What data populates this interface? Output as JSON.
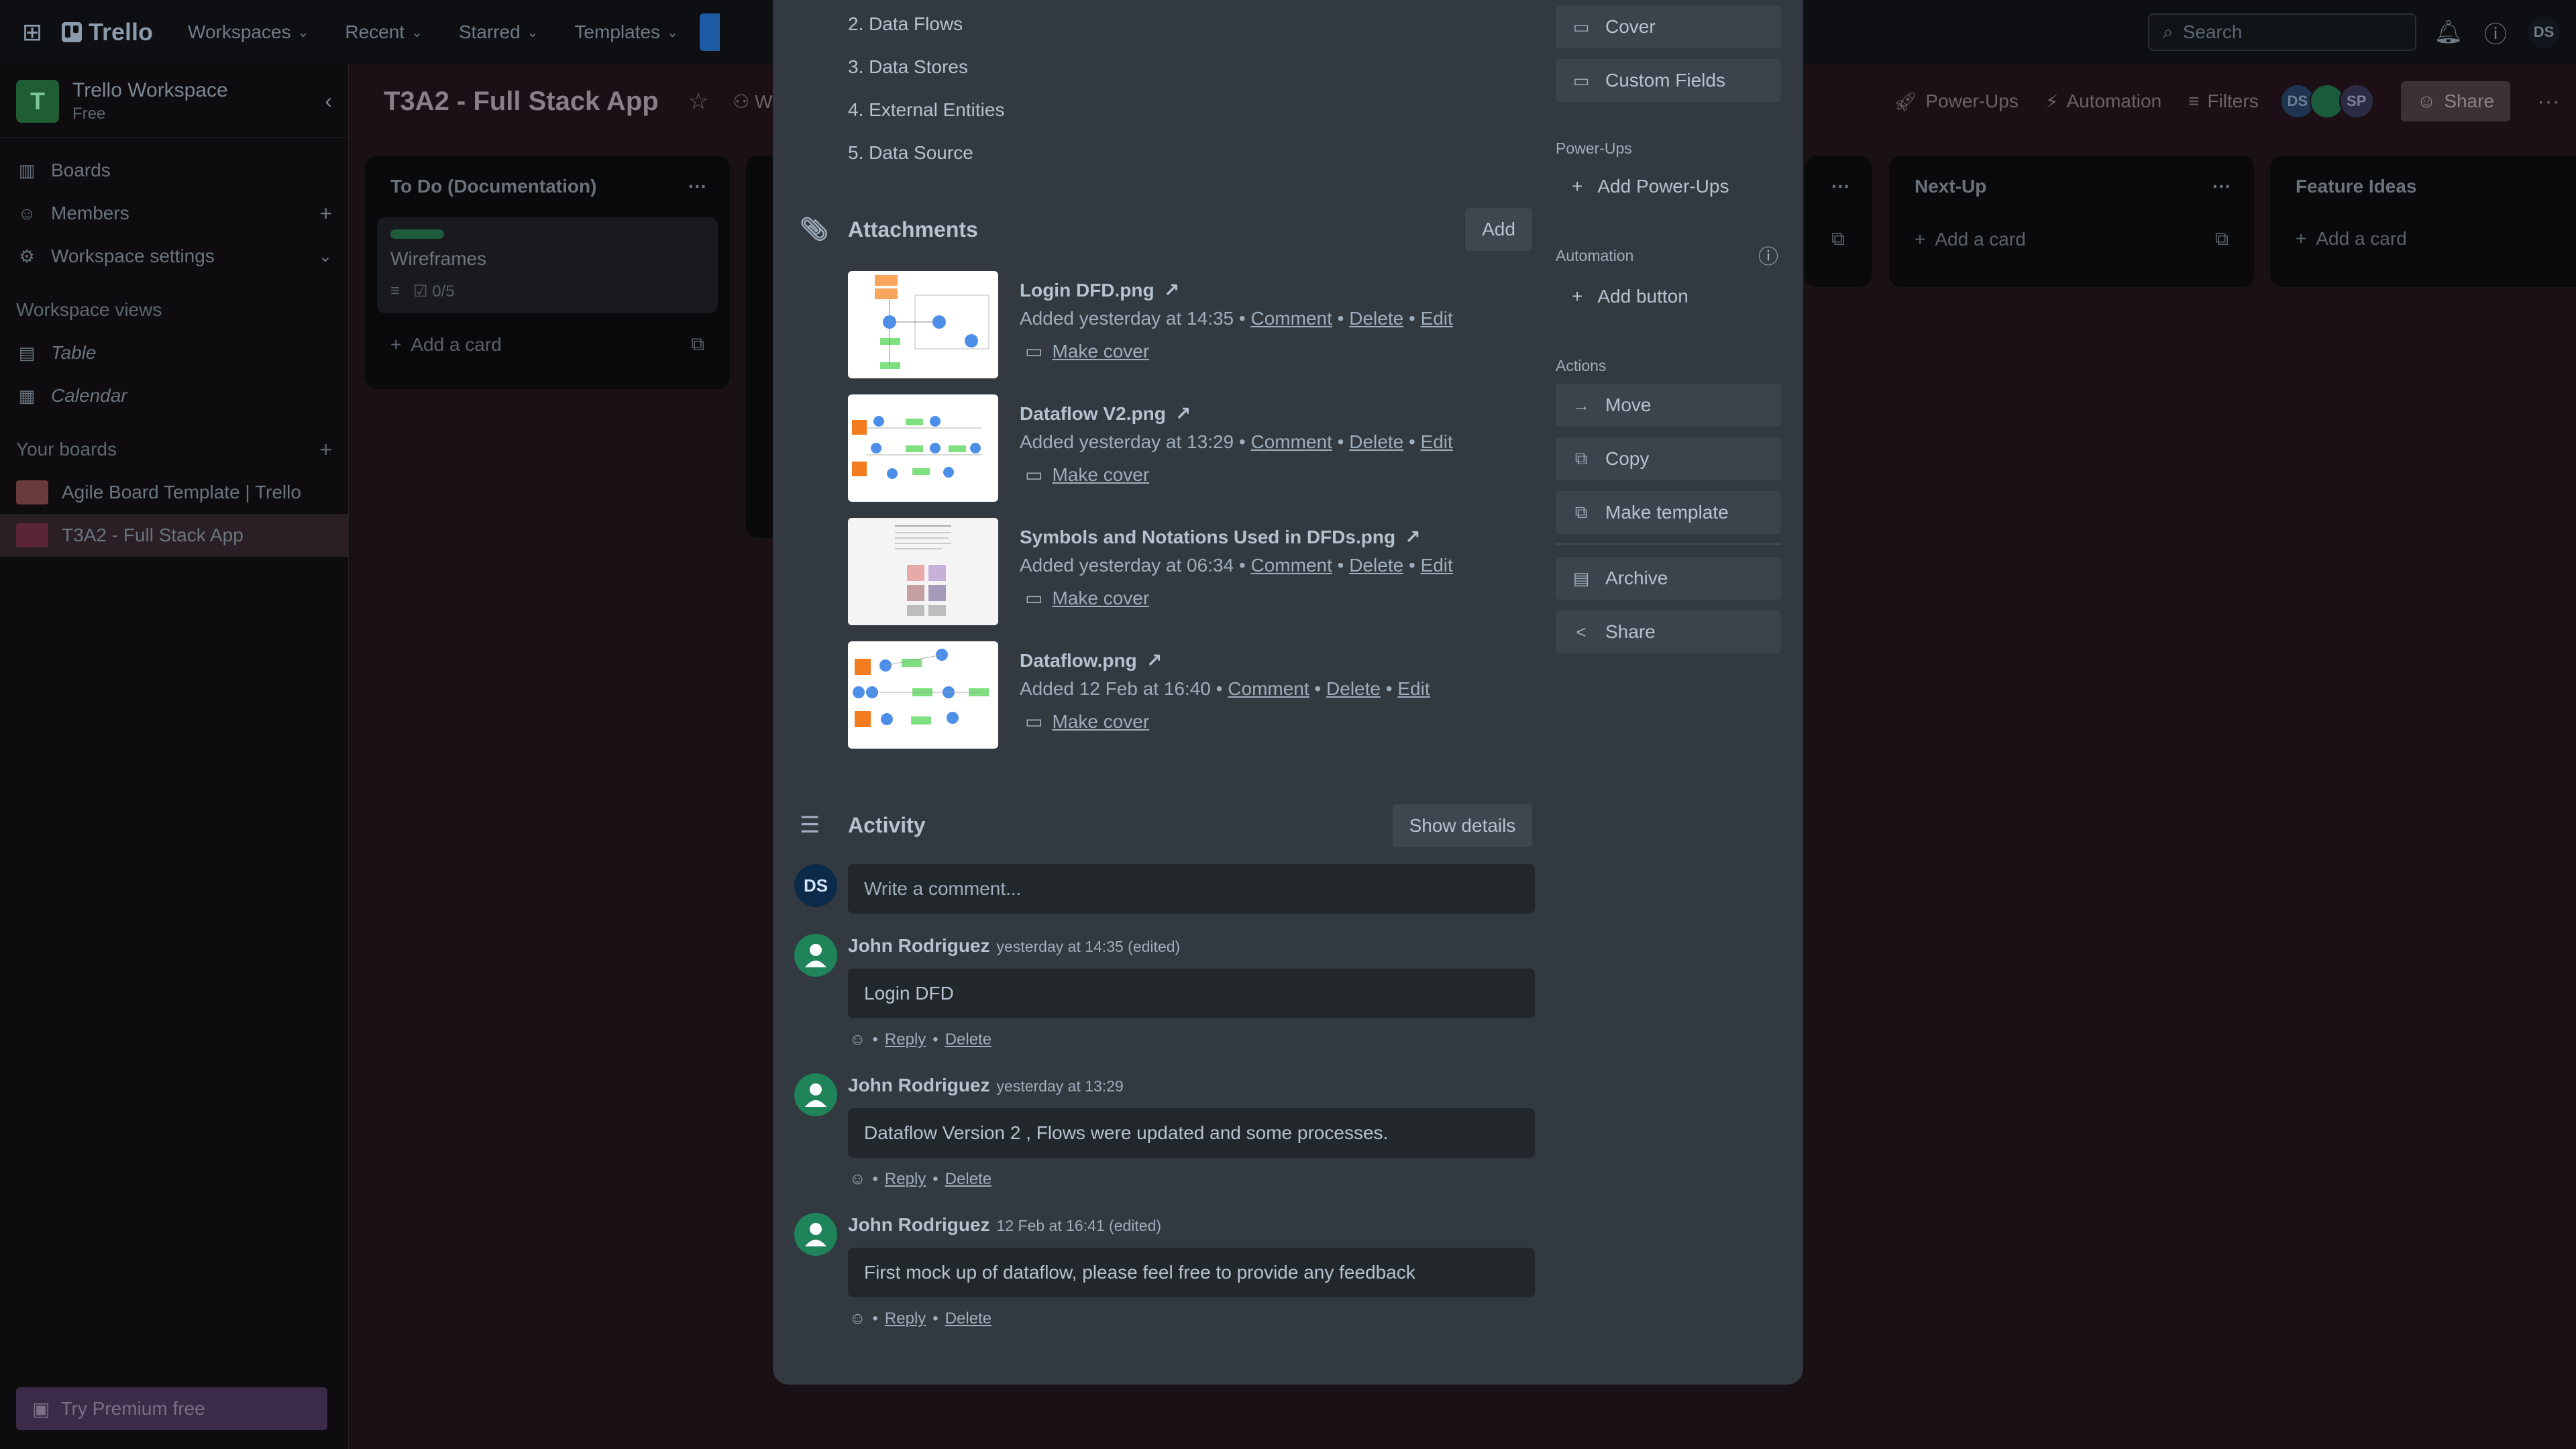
{
  "topbar": {
    "app_name": "Trello",
    "menu": [
      "Workspaces",
      "Recent",
      "Starred",
      "Templates"
    ],
    "search_placeholder": "Search",
    "user_initials": "DS"
  },
  "sidebar": {
    "workspace_name": "Trello Workspace",
    "workspace_initial": "T",
    "workspace_plan": "Free",
    "items": [
      {
        "label": "Boards"
      },
      {
        "label": "Members"
      },
      {
        "label": "Workspace settings"
      }
    ],
    "views_heading": "Workspace views",
    "views": [
      {
        "label": "Table"
      },
      {
        "label": "Calendar"
      }
    ],
    "boards_heading": "Your boards",
    "boards": [
      {
        "label": "Agile Board Template | Trello",
        "color": "#6a3b3b"
      },
      {
        "label": "T3A2 - Full Stack App",
        "color": "#5c2438"
      }
    ],
    "premium_label": "Try Premium free"
  },
  "board": {
    "title": "T3A2 - Full Stack App",
    "visibility_label": "Wo",
    "powerups_label": "Power-Ups",
    "automation_label": "Automation",
    "filters_label": "Filters",
    "share_label": "Share",
    "members": [
      "DS",
      "",
      "SP"
    ]
  },
  "lists": [
    {
      "title": "To Do (Documentation)",
      "card_title": "Wireframes",
      "checklist": "0/5",
      "add_label": "Add a card"
    },
    {
      "title": "Next-Up",
      "add_label": "Add a card"
    },
    {
      "title": "Feature Ideas",
      "add_label": "Add a card"
    }
  ],
  "card_modal": {
    "description_items": [
      "2. Data Flows",
      "3. Data Stores",
      "4. External Entities",
      "5. Data Source"
    ],
    "attachments_heading": "Attachments",
    "add_label": "Add",
    "attachments": [
      {
        "name": "Login DFD.png",
        "added": "Added yesterday at 14:35",
        "comment": "Comment",
        "delete": "Delete",
        "edit": "Edit",
        "cover": "Make cover"
      },
      {
        "name": "Dataflow V2.png",
        "added": "Added yesterday at 13:29",
        "comment": "Comment",
        "delete": "Delete",
        "edit": "Edit",
        "cover": "Make cover"
      },
      {
        "name": "Symbols and Notations Used in DFDs.png",
        "added": "Added yesterday at 06:34",
        "comment": "Comment",
        "delete": "Delete",
        "edit": "Edit",
        "cover": "Make cover"
      },
      {
        "name": "Dataflow.png",
        "added": "Added 12 Feb at 16:40",
        "comment": "Comment",
        "delete": "Delete",
        "edit": "Edit",
        "cover": "Make cover"
      }
    ],
    "activity_heading": "Activity",
    "show_details_label": "Show details",
    "comment_placeholder": "Write a comment...",
    "current_user": "DS",
    "comments": [
      {
        "author": "John Rodriguez",
        "time": "yesterday at 14:35 (edited)",
        "text": "Login DFD",
        "reply": "Reply",
        "delete": "Delete"
      },
      {
        "author": "John Rodriguez",
        "time": "yesterday at 13:29",
        "text": "Dataflow Version 2 , Flows were updated and some processes.",
        "reply": "Reply",
        "delete": "Delete"
      },
      {
        "author": "John Rodriguez",
        "time": "12 Feb at 16:41 (edited)",
        "text": "First mock up of dataflow, please feel free to provide any feedback",
        "reply": "Reply",
        "delete": "Delete"
      }
    ],
    "side": {
      "cover_label": "Cover",
      "custom_fields_label": "Custom Fields",
      "powerups_heading": "Power-Ups",
      "add_powerups_label": "Add Power-Ups",
      "automation_heading": "Automation",
      "add_button_label": "Add button",
      "actions_heading": "Actions",
      "move_label": "Move",
      "copy_label": "Copy",
      "make_template_label": "Make template",
      "archive_label": "Archive",
      "share_label": "Share"
    }
  },
  "colors": {
    "modal_bg": "#323940",
    "avatar_green": "#1f845a",
    "ds_avatar": "#0c2a4a"
  }
}
